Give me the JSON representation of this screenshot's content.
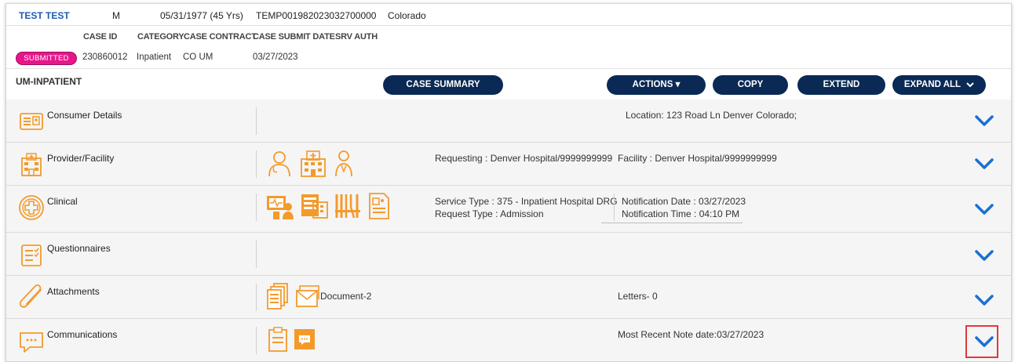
{
  "patient": {
    "name": "TEST TEST",
    "gender": "M",
    "dob": "05/31/1977 (45 Yrs)",
    "member_id": "TEMP001982023032700000",
    "state": "Colorado"
  },
  "case": {
    "headers": {
      "case_id": "CASE ID",
      "category": "CATEGORY",
      "case_contract": "CASE CONTRACT",
      "submit_date": "CASE SUBMIT DATE",
      "srv_auth": "SRV AUTH"
    },
    "status": "SUBMITTED",
    "case_id": "230860012",
    "category": "Inpatient",
    "contract": "CO UM",
    "submit_date": "03/27/2023",
    "status_color": "#e8168a"
  },
  "toolbar": {
    "title": "UM-INPATIENT",
    "case_summary": "CASE SUMMARY",
    "actions": "ACTIONS ▾",
    "copy": "COPY",
    "extend": "EXTEND",
    "expand_all": "EXPAND ALL",
    "button_color": "#0a2a55"
  },
  "sections": {
    "consumer": {
      "title": "Consumer Details",
      "location": "Location: 123 Road Ln Denver Colorado;"
    },
    "provider": {
      "title": "Provider/Facility",
      "requesting": "Requesting : Denver Hospital/9999999999",
      "facility": "Facility : Denver Hospital/9999999999"
    },
    "clinical": {
      "title": "Clinical",
      "service_type": "Service Type : 375 - Inpatient Hospital DRG",
      "request_type": "Request Type : Admission",
      "notification_date": "Notification Date : 03/27/2023",
      "notification_time": "Notification Time : 04:10 PM"
    },
    "questionnaires": {
      "title": "Questionnaires"
    },
    "attachments": {
      "title": "Attachments",
      "document": "Document-2",
      "letters": "Letters- 0"
    },
    "communications": {
      "title": "Communications",
      "recent_note": "Most Recent Note date:03/27/2023"
    }
  },
  "colors": {
    "icon_orange": "#f39a2b",
    "chevron_blue": "#1a6fd4",
    "highlight_red": "#e0393e"
  }
}
